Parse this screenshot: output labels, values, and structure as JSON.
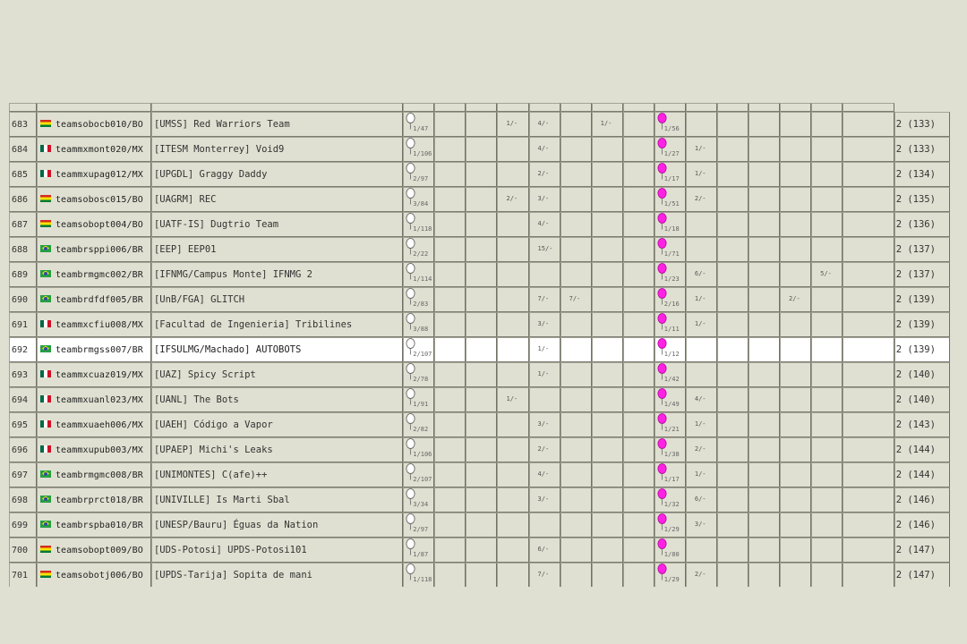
{
  "scoreboard": {
    "rows": [
      {
        "rank": "683",
        "country": "BO",
        "site": "teamsobocb010/BO",
        "name": "[UMSS] Red Warriors Team",
        "p1": "1/47",
        "cells": [
          "",
          "",
          "1/-",
          "4/-",
          "",
          "1/-",
          "",
          "1/56",
          "",
          "",
          "",
          "",
          "",
          ""
        ],
        "total": "2 (133)",
        "highlight": false
      },
      {
        "rank": "684",
        "country": "MX",
        "site": "teammxmont020/MX",
        "name": "[ITESM Monterrey] Void9",
        "p1": "1/106",
        "cells": [
          "",
          "",
          "",
          "4/-",
          "",
          "",
          "",
          "1/27",
          "1/-",
          "",
          "",
          "",
          "",
          ""
        ],
        "total": "2 (133)",
        "highlight": false
      },
      {
        "rank": "685",
        "country": "MX",
        "site": "teammxupag012/MX",
        "name": "[UPGDL] Graggy Daddy",
        "p1": "2/97",
        "cells": [
          "",
          "",
          "",
          "2/-",
          "",
          "",
          "",
          "1/17",
          "1/-",
          "",
          "",
          "",
          "",
          ""
        ],
        "total": "2 (134)",
        "highlight": false
      },
      {
        "rank": "686",
        "country": "BO",
        "site": "teamsobosc015/BO",
        "name": "[UAGRM] REC",
        "p1": "3/84",
        "cells": [
          "",
          "",
          "2/-",
          "3/-",
          "",
          "",
          "",
          "1/51",
          "2/-",
          "",
          "",
          "",
          "",
          ""
        ],
        "total": "2 (135)",
        "highlight": false
      },
      {
        "rank": "687",
        "country": "BO",
        "site": "teamsobopt004/BO",
        "name": "[UATF-IS] Dugtrio Team",
        "p1": "1/118",
        "cells": [
          "",
          "",
          "",
          "4/-",
          "",
          "",
          "",
          "1/18",
          "",
          "",
          "",
          "",
          "",
          ""
        ],
        "total": "2 (136)",
        "highlight": false
      },
      {
        "rank": "688",
        "country": "BR",
        "site": "teambrsppi006/BR",
        "name": "[EEP] EEP01",
        "p1": "2/22",
        "cells": [
          "",
          "",
          "",
          "15/-",
          "",
          "",
          "",
          "1/71",
          "",
          "",
          "",
          "",
          "",
          ""
        ],
        "total": "2 (137)",
        "highlight": false
      },
      {
        "rank": "689",
        "country": "BR",
        "site": "teambrmgmc002/BR",
        "name": "[IFNMG/Campus Monte] IFNMG 2",
        "p1": "1/114",
        "cells": [
          "",
          "",
          "",
          "",
          "",
          "",
          "",
          "1/23",
          "6/-",
          "",
          "",
          "",
          "5/-",
          ""
        ],
        "total": "2 (137)",
        "highlight": false
      },
      {
        "rank": "690",
        "country": "BR",
        "site": "teambrdfdf005/BR",
        "name": "[UnB/FGA] GLITCH",
        "p1": "2/83",
        "cells": [
          "",
          "",
          "",
          "7/-",
          "7/-",
          "",
          "",
          "2/16",
          "1/-",
          "",
          "",
          "2/-",
          "",
          ""
        ],
        "total": "2 (139)",
        "highlight": false
      },
      {
        "rank": "691",
        "country": "MX",
        "site": "teammxcfiu008/MX",
        "name": "[Facultad de Ingenieria] Tribilines",
        "p1": "3/88",
        "cells": [
          "",
          "",
          "",
          "3/-",
          "",
          "",
          "",
          "1/11",
          "1/-",
          "",
          "",
          "",
          "",
          ""
        ],
        "total": "2 (139)",
        "highlight": false
      },
      {
        "rank": "692",
        "country": "BR",
        "site": "teambrmgss007/BR",
        "name": "[IFSULMG/Machado] AUTOBOTS",
        "p1": "2/107",
        "cells": [
          "",
          "",
          "",
          "1/-",
          "",
          "",
          "",
          "1/12",
          "",
          "",
          "",
          "",
          "",
          ""
        ],
        "total": "2 (139)",
        "highlight": true
      },
      {
        "rank": "693",
        "country": "MX",
        "site": "teammxcuaz019/MX",
        "name": "[UAZ] Spicy Script",
        "p1": "2/78",
        "cells": [
          "",
          "",
          "",
          "1/-",
          "",
          "",
          "",
          "1/42",
          "",
          "",
          "",
          "",
          "",
          ""
        ],
        "total": "2 (140)",
        "highlight": false
      },
      {
        "rank": "694",
        "country": "MX",
        "site": "teammxuanl023/MX",
        "name": "[UANL] The Bots",
        "p1": "1/91",
        "cells": [
          "",
          "",
          "1/-",
          "",
          "",
          "",
          "",
          "1/49",
          "4/-",
          "",
          "",
          "",
          "",
          ""
        ],
        "total": "2 (140)",
        "highlight": false
      },
      {
        "rank": "695",
        "country": "MX",
        "site": "teammxuaeh006/MX",
        "name": "[UAEH] Código a Vapor",
        "p1": "2/82",
        "cells": [
          "",
          "",
          "",
          "3/-",
          "",
          "",
          "",
          "1/21",
          "1/-",
          "",
          "",
          "",
          "",
          ""
        ],
        "total": "2 (143)",
        "highlight": false
      },
      {
        "rank": "696",
        "country": "MX",
        "site": "teammxupub003/MX",
        "name": "[UPAEP] Michi's Leaks",
        "p1": "1/106",
        "cells": [
          "",
          "",
          "",
          "2/-",
          "",
          "",
          "",
          "1/38",
          "2/-",
          "",
          "",
          "",
          "",
          ""
        ],
        "total": "2 (144)",
        "highlight": false
      },
      {
        "rank": "697",
        "country": "BR",
        "site": "teambrmgmc008/BR",
        "name": "[UNIMONTES] C(afe)++",
        "p1": "2/107",
        "cells": [
          "",
          "",
          "",
          "4/-",
          "",
          "",
          "",
          "1/17",
          "1/-",
          "",
          "",
          "",
          "",
          ""
        ],
        "total": "2 (144)",
        "highlight": false
      },
      {
        "rank": "698",
        "country": "BR",
        "site": "teambrprct018/BR",
        "name": "[UNIVILLE] Is Marti Sbal",
        "p1": "3/34",
        "cells": [
          "",
          "",
          "",
          "3/-",
          "",
          "",
          "",
          "1/32",
          "6/-",
          "",
          "",
          "",
          "",
          ""
        ],
        "total": "2 (146)",
        "highlight": false
      },
      {
        "rank": "699",
        "country": "BR",
        "site": "teambrspba010/BR",
        "name": "[UNESP/Bauru] Éguas da Nation",
        "p1": "2/97",
        "cells": [
          "",
          "",
          "",
          "",
          "",
          "",
          "",
          "1/29",
          "3/-",
          "",
          "",
          "",
          "",
          ""
        ],
        "total": "2 (146)",
        "highlight": false
      },
      {
        "rank": "700",
        "country": "BO",
        "site": "teamsobopt009/BO",
        "name": "[UDS-Potosi] UPDS-Potosi101",
        "p1": "1/87",
        "cells": [
          "",
          "",
          "",
          "6/-",
          "",
          "",
          "",
          "1/80",
          "",
          "",
          "",
          "",
          "",
          ""
        ],
        "total": "2 (147)",
        "highlight": false
      },
      {
        "rank": "701",
        "country": "BO",
        "site": "teamsobotj006/BO",
        "name": "[UPDS-Tarija] Sopita de mani",
        "p1": "1/118",
        "cells": [
          "",
          "",
          "",
          "7/-",
          "",
          "",
          "",
          "1/29",
          "2/-",
          "",
          "",
          "",
          "",
          ""
        ],
        "total": "2 (147)",
        "highlight": false
      }
    ]
  },
  "colors": {
    "background": "#dfe0d1",
    "balloon_white": "#ffffff",
    "balloon_magenta": "#ff22e4",
    "highlight_row": "#ffffff"
  },
  "icons": {
    "white_balloon": "balloon-white-icon",
    "magenta_balloon": "balloon-magenta-icon",
    "flag_bo": "flag-bolivia-icon",
    "flag_mx": "flag-mexico-icon",
    "flag_br": "flag-brazil-icon"
  }
}
